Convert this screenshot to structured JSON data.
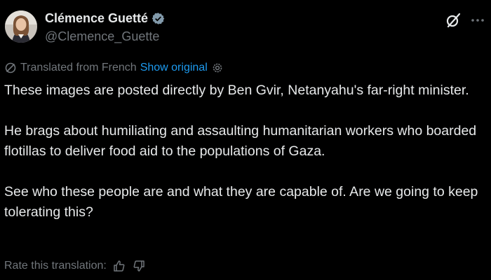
{
  "author": {
    "display_name": "Clémence Guetté",
    "handle": "@Clemence_Guette",
    "verified": true
  },
  "translation": {
    "label": "Translated from French",
    "show_original": "Show original"
  },
  "post": {
    "paragraphs": [
      "These images are posted directly by Ben Gvir, Netanyahu's far-right minister.",
      "He brags about humiliating and assaulting humanitarian workers who boarded flotillas to deliver food aid to the populations of Gaza.",
      "See who these people are and what they are capable of. Are we going to keep tolerating this?"
    ]
  },
  "rating": {
    "label": "Rate this translation:"
  },
  "icons": {
    "verified": "verified-badge-icon",
    "grok": "grok-icon",
    "more": "more-options-icon",
    "translate": "translate-icon",
    "settings": "gear-icon",
    "thumbs_up": "thumbs-up-icon",
    "thumbs_down": "thumbs-down-icon"
  },
  "colors": {
    "background": "#000000",
    "text_primary": "#e7e9ea",
    "text_secondary": "#71767b",
    "link": "#1d9bf0"
  }
}
